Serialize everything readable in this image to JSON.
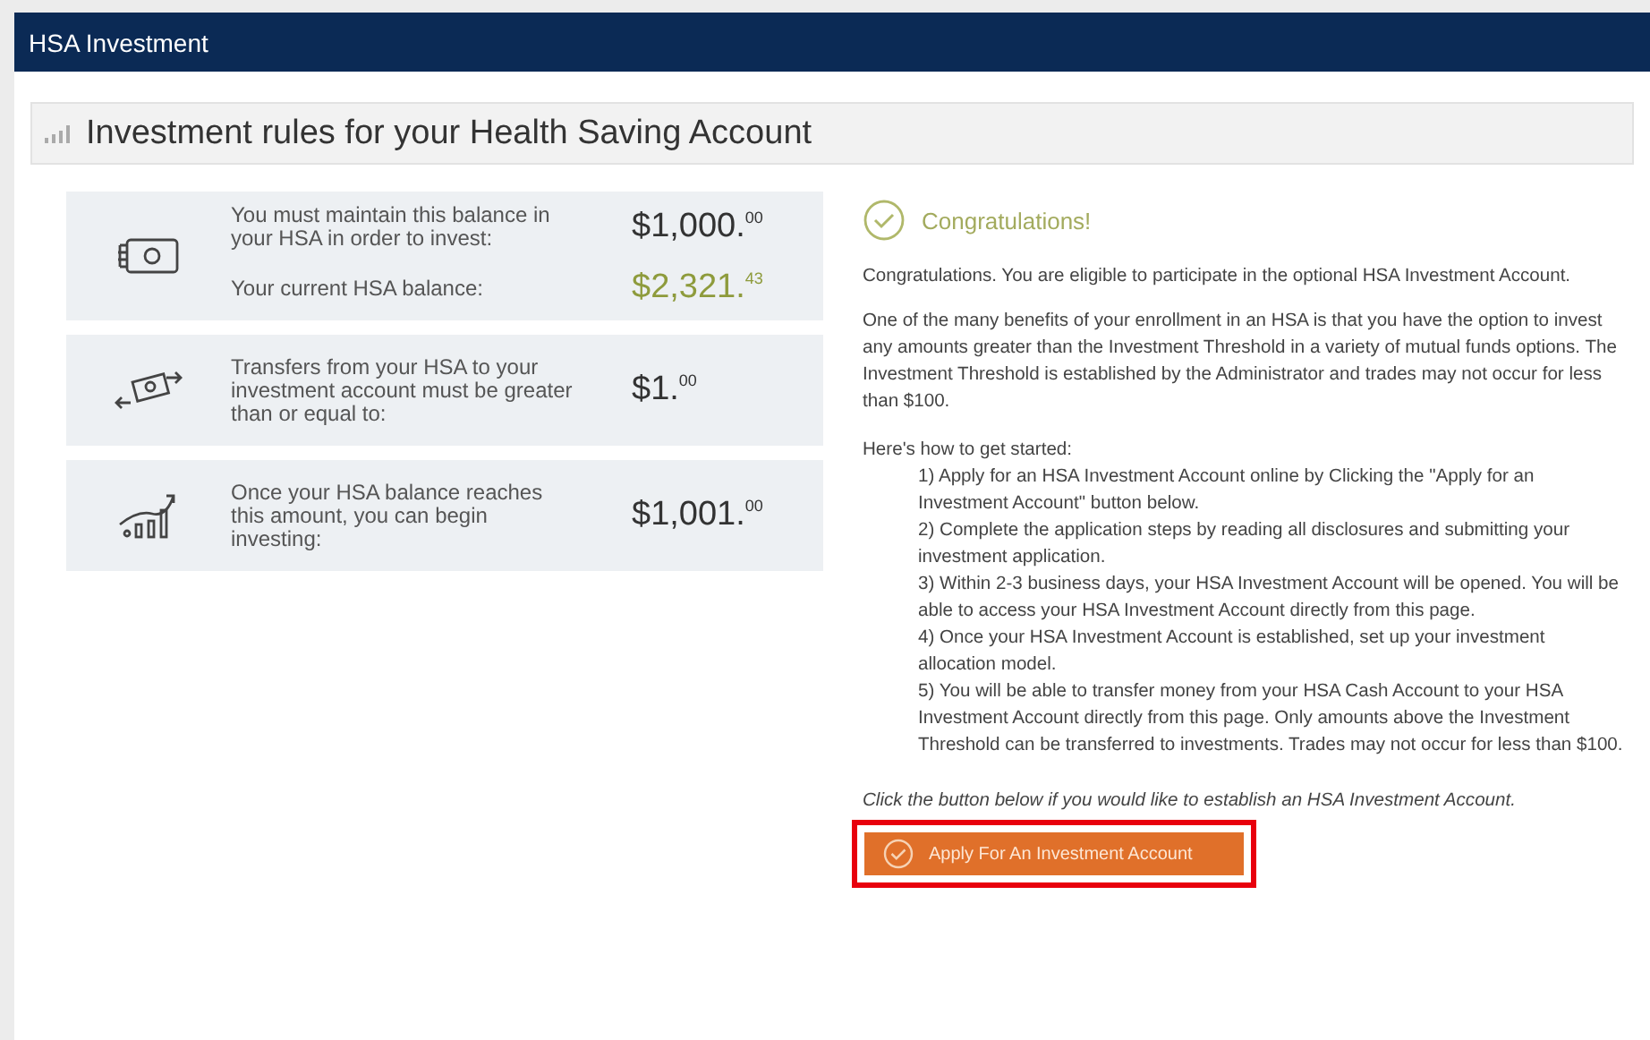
{
  "header": {
    "title": "HSA Investment"
  },
  "panel": {
    "title": "Investment rules for your Health Saving Account"
  },
  "rules": [
    {
      "lines": [
        {
          "label": "You must maintain this balance in your HSA in order to invest:",
          "amount": "$1,000.$^{00}$",
          "positive": false
        },
        {
          "label": "Your current HSA balance:",
          "amount": "$2,321.$^{43}$",
          "positive": true
        }
      ]
    },
    {
      "lines": [
        {
          "label": "Transfers from your HSA to your investment account must be greater than or equal to:",
          "amount": "$1.$^{00}$",
          "positive": false
        }
      ]
    },
    {
      "lines": [
        {
          "label": "Once your HSA balance reaches this amount, you can begin investing:",
          "amount": "$1,001.$^{00}$",
          "positive": false
        }
      ]
    }
  ],
  "info": {
    "heading": "Congratulations!",
    "paragraphs": [
      "Congratulations. You are eligible to participate in the optional HSA Investment Account.",
      "One of the many benefits of your enrollment in an HSA is that you have the option to invest any amounts greater than the Investment Threshold in a variety of mutual funds options. The Investment Threshold is established by the Administrator and trades may not occur for less than $100."
    ],
    "steps_intro": "Here's how to get started:",
    "steps": [
      "1)  Apply for an HSA Investment Account online by Clicking the \"Apply for an Investment Account\" button below.",
      "2)  Complete the application steps by reading all disclosures and submitting your investment application.",
      "3)  Within 2-3 business days, your HSA Investment Account will be opened. You will be able to access your HSA Investment Account directly from this page.",
      "4)  Once your HSA Investment Account is established, set up your investment allocation model.",
      "5)  You will be able to transfer money from your HSA Cash Account to your HSA Investment Account directly from this page. Only amounts above the Investment Threshold can be transferred to investments. Trades may not occur for less than $100."
    ],
    "note": "Click the button below if you would like to establish an HSA Investment Account.",
    "button": {
      "label": "Apply For An Investment Account",
      "highlighted": true
    }
  }
}
